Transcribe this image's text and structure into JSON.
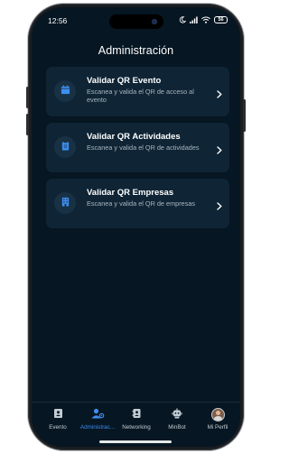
{
  "status_bar": {
    "time": "12:56",
    "battery": "56"
  },
  "header": {
    "title": "Administración"
  },
  "cards": [
    {
      "icon": "calendar-icon",
      "title": "Validar QR Evento",
      "description": "Escanea y valida el QR de acceso al evento"
    },
    {
      "icon": "clipboard-icon",
      "title": "Validar QR Actividades",
      "description": "Escanea y valida el QR de actividades"
    },
    {
      "icon": "building-icon",
      "title": "Validar QR Empresas",
      "description": "Escanea y valida el QR de empresas"
    }
  ],
  "bottom_nav": {
    "active_index": 1,
    "items": [
      {
        "label": "Evento",
        "icon": "badge-icon"
      },
      {
        "label": "Administrac...",
        "icon": "admin-user-icon"
      },
      {
        "label": "Networking",
        "icon": "contacts-icon"
      },
      {
        "label": "MinBot",
        "icon": "robot-icon"
      },
      {
        "label": "Mi Perfil",
        "icon": "avatar"
      }
    ]
  },
  "colors": {
    "background": "#061622",
    "card": "#0f2434",
    "accent": "#3d8ef0",
    "text_primary": "#ffffff",
    "text_secondary": "#a8b7c2"
  }
}
